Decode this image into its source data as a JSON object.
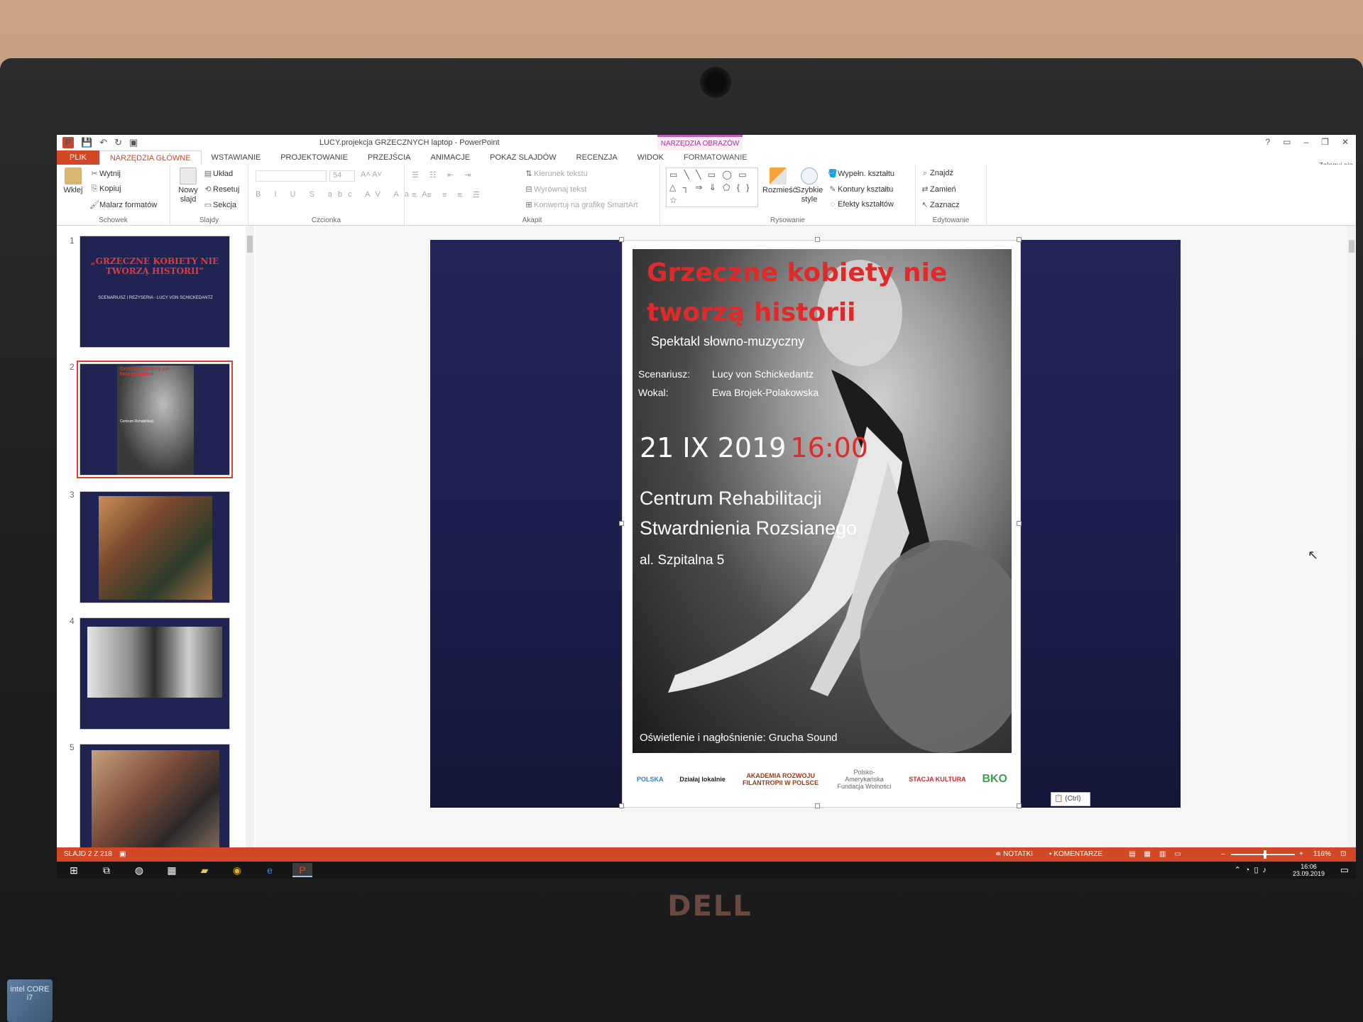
{
  "window": {
    "title": "LUCY.projekcja GRZECZNYCH laptop - PowerPoint",
    "contextual_group": "NARZĘDZIA OBRAZÓW",
    "signin": "Zaloguj się",
    "controls": [
      "?",
      "▭",
      "–",
      "❐",
      "✕"
    ]
  },
  "tabs": [
    "PLIK",
    "NARZĘDZIA GŁÓWNE",
    "WSTAWIANIE",
    "PROJEKTOWANIE",
    "PRZEJŚCIA",
    "ANIMACJE",
    "POKAZ SLAJDÓW",
    "RECENZJA",
    "WIDOK",
    "FORMATOWANIE"
  ],
  "ribbon": {
    "schowek": {
      "label": "Schowek",
      "paste": "Wklej",
      "cut": "Wytnij",
      "copy": "Kopiuj",
      "format_painter": "Malarz formatów"
    },
    "slajdy": {
      "label": "Slajdy",
      "new_slide": "Nowy slajd",
      "layout": "Układ",
      "reset": "Resetuj",
      "section": "Sekcja"
    },
    "czcionka": {
      "label": "Czcionka",
      "font_size": "54"
    },
    "akapit": {
      "label": "Akapit",
      "text_direction": "Kierunek tekstu",
      "align_text": "Wyrównaj tekst",
      "smartart": "Konwertuj na grafikę SmartArt"
    },
    "rysowanie": {
      "label": "Rysowanie",
      "arrange": "Rozmieść",
      "quick_styles": "Szybkie style",
      "fill": "Wypełn. kształtu",
      "outline": "Kontury kształtu",
      "effects": "Efekty kształtów"
    },
    "edytowanie": {
      "label": "Edytowanie",
      "find": "Znajdź",
      "replace": "Zamień",
      "select": "Zaznacz"
    }
  },
  "thumbnails": [
    {
      "num": "1",
      "title": "„GRZECZNE KOBIETY NIE TWORZĄ HISTORII”",
      "subtitle": "SCENARIUSZ I REŻYSERIA - LUCY VON SCHICKEDANTZ"
    },
    {
      "num": "2",
      "title": "Grzeczne kobiety nie tworzą historii",
      "subtitle": "Centrum Rehabilitacji"
    },
    {
      "num": "3"
    },
    {
      "num": "4"
    },
    {
      "num": "5"
    }
  ],
  "poster": {
    "title_line1": "Grzeczne kobiety nie",
    "title_line2": "tworzą historii",
    "subtitle": "Spektakl słowno-muzyczny",
    "credits": [
      {
        "role": "Scenariusz:",
        "name": "Lucy von Schickedantz"
      },
      {
        "role": "Wokal:",
        "name": "Ewa Brojek-Polakowska"
      }
    ],
    "date": "21 IX 2019",
    "time": "16:00",
    "venue_line1": "Centrum Rehabilitacji",
    "venue_line2": "Stwardnienia Rozsianego",
    "address": "al. Szpitalna 5",
    "lighting": "Oświetlenie i nagłośnienie: Grucha Sound",
    "logos": [
      "POLSKA",
      "Działaj lokalnie",
      "AKADEMIA ROZWOJU FILANTROPII W POLSCE",
      "Polsko-Amerykańska Fundacja Wolności",
      "STACJA KULTURA",
      "BKO"
    ]
  },
  "paste_tag": "(Ctrl)",
  "statusbar": {
    "slide_info": "SLAJD 2 Z 218",
    "notes": "NOTATKI",
    "comments": "KOMENTARZE",
    "zoom": "116%"
  },
  "taskbar": {
    "time": "16:06",
    "date": "23.09.2019"
  },
  "brand": "DELL",
  "sticker": "intel CORE i7"
}
